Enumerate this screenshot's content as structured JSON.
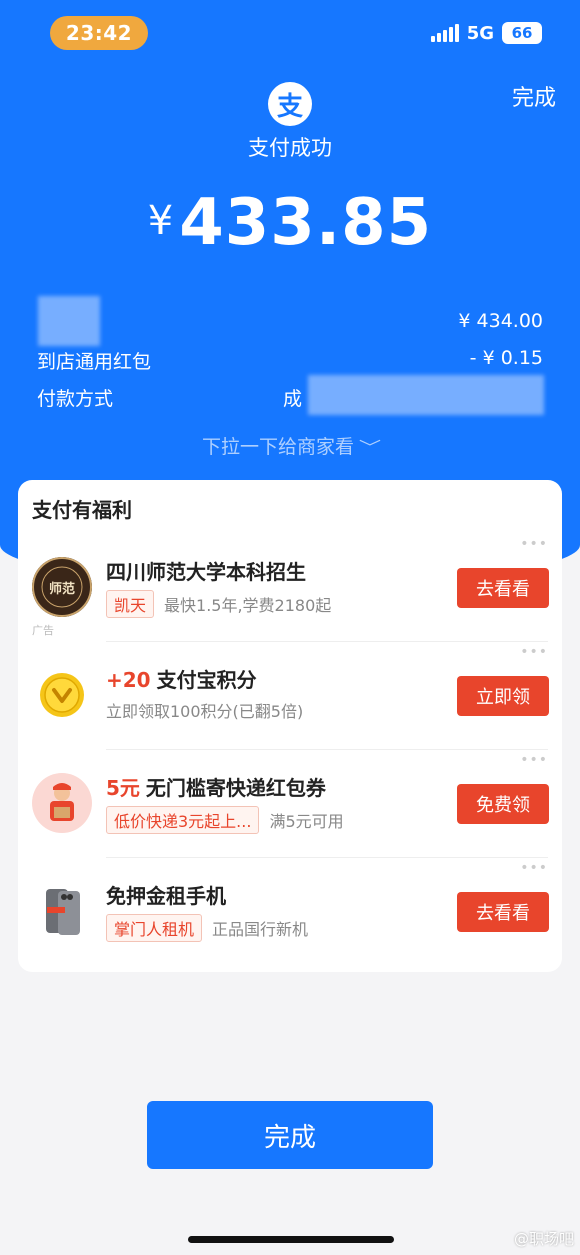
{
  "status_bar": {
    "time": "23:42",
    "network": "5G",
    "battery": "66"
  },
  "header": {
    "done_label": "完成",
    "logo_char": "支",
    "title": "支付成功",
    "currency": "¥",
    "amount": "433.85"
  },
  "details": {
    "original_amount": "¥ 434.00",
    "discount_label": "到店通用红包",
    "discount_value": "- ¥ 0.15",
    "payment_method_label": "付款方式",
    "payment_method_value": "成"
  },
  "pull_hint": {
    "text": "下拉一下给商家看",
    "chevron": "﹀"
  },
  "benefits": {
    "title": "支付有福利",
    "items": [
      {
        "title": "四川师范大学本科招生",
        "tag": "凯天",
        "sub": "最快1.5年,学费2180起",
        "cta": "去看看",
        "ad_label": "广告",
        "icon": "university-logo-icon"
      },
      {
        "highlight": "+20",
        "title": "支付宝积分",
        "sub": "立即领取100积分(已翻5倍)",
        "cta": "立即领",
        "icon": "points-coin-icon"
      },
      {
        "highlight": "5元",
        "title": "无门槛寄快递红包券",
        "tag": "低价快递3元起上...",
        "sub": "满5元可用",
        "cta": "免费领",
        "icon": "courier-icon"
      },
      {
        "title": "免押金租手机",
        "tag": "掌门人租机",
        "sub": "正品国行新机",
        "cta": "去看看",
        "icon": "phone-rental-icon"
      }
    ]
  },
  "footer": {
    "done_label": "完成",
    "watermark": "@职场吧"
  },
  "colors": {
    "brand_blue": "#1677ff",
    "cta_red": "#e8452c",
    "time_pill": "#f0a83e"
  }
}
